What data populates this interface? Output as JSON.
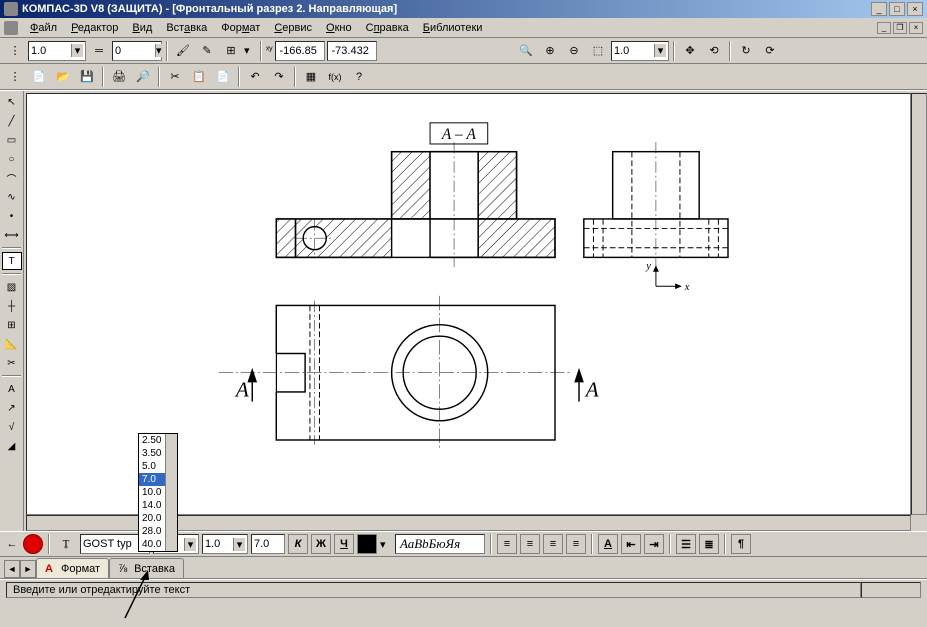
{
  "title": "КОМПАС-3D V8 (ЗАЩИТА) - [Фронтальный разрез 2. Направляющая]",
  "menus": {
    "file": "Файл",
    "edit": "Редактор",
    "view": "Вид",
    "insert": "Вставка",
    "format": "Формат",
    "service": "Сервис",
    "window": "Окно",
    "help": "Справка",
    "libs": "Библиотеки"
  },
  "toolbar1": {
    "combo1": "1.0",
    "combo2": "0",
    "coord_label_x": "x",
    "coord_label_y": "y",
    "coord_x": "-166.85",
    "coord_y": "-73.432"
  },
  "zoom": {
    "value": "1.0"
  },
  "canvas": {
    "section_label": "А – А",
    "arrow_left": "А",
    "arrow_right": "А",
    "axis_x": "x",
    "axis_y": "y"
  },
  "dropdown": {
    "options": [
      "2.50",
      "3.50",
      "5.0",
      "7.0",
      "10.0",
      "14.0",
      "20.0",
      "28.0",
      "40.0"
    ],
    "selected": "7.0"
  },
  "bottombar": {
    "font": "GOST typ",
    "size": "7.0",
    "step": "1.0",
    "size2": "7.0",
    "bold": "К",
    "italic": "Ж",
    "underline": "Ч",
    "preview": "АаВbБюЯя"
  },
  "tabs": {
    "tab1": "Формат",
    "tab2": "Вставка"
  },
  "status": "Введите или отредактируйте текст"
}
